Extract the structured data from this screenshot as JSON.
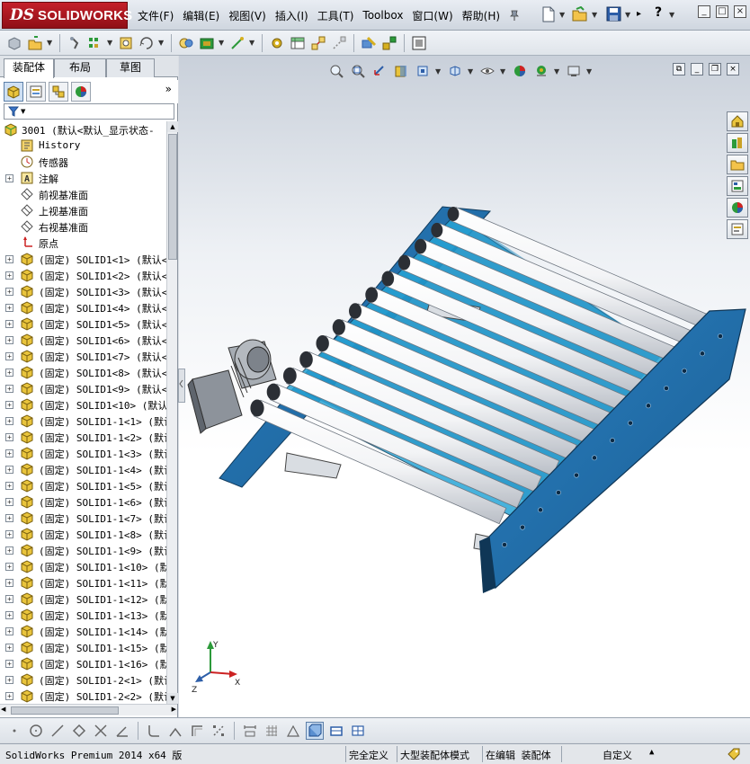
{
  "app": {
    "logo_ds": "DS",
    "logo_name": "SOLIDWORKS"
  },
  "menu": {
    "items": [
      "文件(F)",
      "编辑(E)",
      "视图(V)",
      "插入(I)",
      "工具(T)",
      "Toolbox",
      "窗口(W)",
      "帮助(H)"
    ]
  },
  "left_panel": {
    "tabs": [
      "装配体",
      "布局",
      "草图"
    ],
    "tree_root": "3001 (默认<默认_显示状态-",
    "tree_items": [
      {
        "label": "History",
        "icon": "history-icon",
        "expand": false
      },
      {
        "label": "传感器",
        "icon": "sensor-icon",
        "expand": false
      },
      {
        "label": "注解",
        "icon": "annotation-icon",
        "expand": true
      },
      {
        "label": "前视基准面",
        "icon": "plane-icon",
        "expand": false
      },
      {
        "label": "上视基准面",
        "icon": "plane-icon",
        "expand": false
      },
      {
        "label": "右视基准面",
        "icon": "plane-icon",
        "expand": false
      },
      {
        "label": "原点",
        "icon": "origin-icon",
        "expand": false
      }
    ],
    "components": [
      "(固定) SOLID1<1> (默认<",
      "(固定) SOLID1<2> (默认<",
      "(固定) SOLID1<3> (默认<",
      "(固定) SOLID1<4> (默认<",
      "(固定) SOLID1<5> (默认<",
      "(固定) SOLID1<6> (默认<",
      "(固定) SOLID1<7> (默认<",
      "(固定) SOLID1<8> (默认<",
      "(固定) SOLID1<9> (默认<",
      "(固定) SOLID1<10> (默认",
      "(固定) SOLID1-1<1> (默认",
      "(固定) SOLID1-1<2> (默认",
      "(固定) SOLID1-1<3> (默认",
      "(固定) SOLID1-1<4> (默认",
      "(固定) SOLID1-1<5> (默认",
      "(固定) SOLID1-1<6> (默认",
      "(固定) SOLID1-1<7> (默认",
      "(固定) SOLID1-1<8> (默认",
      "(固定) SOLID1-1<9> (默认",
      "(固定) SOLID1-1<10> (默",
      "(固定) SOLID1-1<11> (默",
      "(固定) SOLID1-1<12> (默",
      "(固定) SOLID1-1<13> (默",
      "(固定) SOLID1-1<14> (默",
      "(固定) SOLID1-1<15> (默",
      "(固定) SOLID1-1<16> (默",
      "(固定) SOLID1-2<1> (默认",
      "(固定) SOLID1-2<2> (默认"
    ]
  },
  "triad": {
    "x": "X",
    "y": "Y",
    "z": "Z"
  },
  "status": {
    "product": "SolidWorks Premium 2014 x64 版",
    "defined": "完全定义",
    "mode": "大型装配体模式",
    "editing": "在编辑 装配体",
    "units": "自定义"
  },
  "colors": {
    "frame_blue": "#1f6fa8",
    "roller": "#f4f5f6",
    "accent_red": "#b8121c",
    "belt_cyan": "#27a5d6"
  }
}
